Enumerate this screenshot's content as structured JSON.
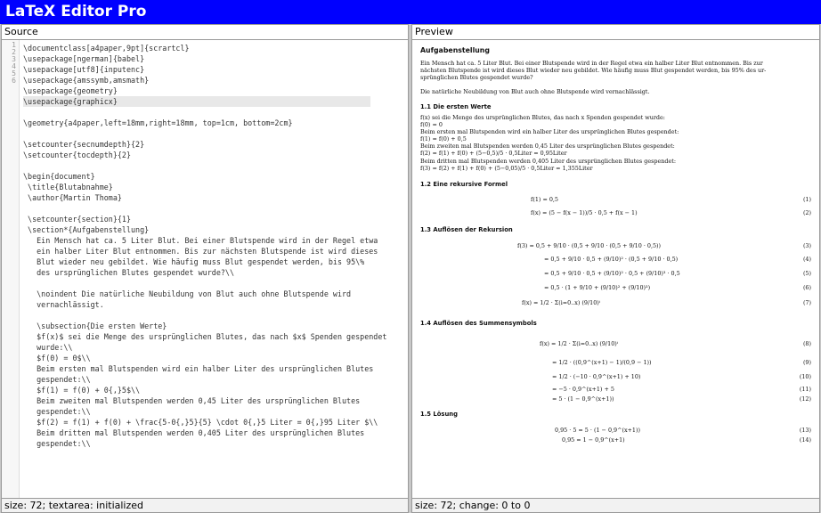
{
  "app": {
    "title": "LaTeX Editor Pro"
  },
  "source": {
    "header": "Source",
    "footer": "size: 72; textarea: initialized",
    "gutter": [
      "1",
      "2",
      "3",
      "4",
      "5",
      "6"
    ],
    "lines": [
      "\\documentclass[a4paper,9pt]{scrartcl}",
      "\\usepackage[ngerman]{babel}",
      "\\usepackage[utf8]{inputenc}",
      "\\usepackage{amssymb,amsmath}",
      "\\usepackage{geometry}",
      "\\usepackage{graphicx}",
      "",
      "\\geometry{a4paper,left=18mm,right=18mm, top=1cm, bottom=2cm}",
      "",
      "\\setcounter{secnumdepth}{2}",
      "\\setcounter{tocdepth}{2}",
      "",
      "\\begin{document}",
      " \\title{Blutabnahme}",
      " \\author{Martin Thoma}",
      "",
      " \\setcounter{section}{1}",
      " \\section*{Aufgabenstellung}",
      "   Ein Mensch hat ca. 5 Liter Blut. Bei einer Blutspende wird in der Regel etwa",
      "   ein halber Liter Blut entnommen. Bis zur nächsten Blutspende ist wird dieses",
      "   Blut wieder neu gebildet. Wie häufig muss Blut gespendet werden, bis 95\\%",
      "   des ursprünglichen Blutes gespendet wurde?\\\\",
      "",
      "   \\noindent Die natürliche Neubildung von Blut auch ohne Blutspende wird",
      "   vernachlässigt.",
      "",
      "   \\subsection{Die ersten Werte}",
      "   $f(x)$ sei die Menge des ursprünglichen Blutes, das nach $x$ Spenden gespendet",
      "   wurde:\\\\",
      "   $f(0) = 0$\\\\",
      "   Beim ersten mal Blutspenden wird ein halber Liter des ursprünglichen Blutes",
      "   gespendet:\\\\",
      "   $f(1) = f(0) + 0{,}5$\\\\",
      "   Beim zweiten mal Blutspenden werden 0,45 Liter des ursprünglichen Blutes",
      "   gespendet:\\\\",
      "   $f(2) = f(1) + f(0) + \\frac{5-0{,}5}{5} \\cdot 0{,}5 Liter = 0{,}95 Liter $\\\\",
      "   Beim dritten mal Blutspenden werden 0,405 Liter des ursprünglichen Blutes",
      "   gespendet:\\\\"
    ]
  },
  "preview": {
    "header": "Preview",
    "footer": "size: 72; change: 0 to 0",
    "title": "Aufgabenstellung",
    "intro": [
      "Ein Mensch hat ca. 5 Liter Blut. Bei einer Blutspende wird in der Regel etwa ein halber Liter Blut entnommen. Bis zur",
      "nächsten Blutspende ist wird dieses Blut wieder neu gebildet. Wie häufig muss Blut gespendet werden, bis 95% des ur-",
      "sprünglichen Blutes gespendet wurde?"
    ],
    "note": "Die natürliche Neubildung von Blut auch ohne Blutspende wird vernachlässigt.",
    "s1": {
      "title": "1.1  Die ersten Werte",
      "lines": [
        "f(x) sei die Menge des ursprünglichen Blutes, das nach x Spenden gespendet wurde:",
        "f(0) = 0",
        "Beim ersten mal Blutspenden wird ein halber Liter des ursprünglichen Blutes gespendet:",
        "f(1) = f(0) + 0,5",
        "Beim zweiten mal Blutspenden werden 0,45 Liter des ursprünglichen Blutes gespendet:",
        "f(2) = f(1) + f(0) + (5−0,5)/5 · 0,5Liter = 0,95Liter",
        "Beim dritten mal Blutspenden werden 0,405 Liter des ursprünglichen Blutes gespendet:",
        "f(3) = f(2) + f(1) + f(0) + (5−0,05)/5 · 0,5Liter = 1,355Liter"
      ]
    },
    "s2": {
      "title": "1.2  Eine rekursive Formel",
      "eqs": [
        {
          "t": "f(1) = 0,5",
          "n": "(1)"
        },
        {
          "t": "f(x) = (5 − f(x − 1))/5 · 0,5 + f(x − 1)",
          "n": "(2)"
        }
      ]
    },
    "s3": {
      "title": "1.3  Auflösen der Rekursion",
      "eqs": [
        {
          "t": "f(3) = 0,5 + 9/10 · (0,5 + 9/10 · (0,5 + 9/10 · 0,5))",
          "n": "(3)"
        },
        {
          "t": "= 0,5 + 9/10 · 0,5 + (9/10)² · (0,5 + 9/10 · 0,5)",
          "n": "(4)"
        },
        {
          "t": "= 0,5 + 9/10 · 0,5 + (9/10)² · 0,5 + (9/10)³ · 0,5",
          "n": "(5)"
        },
        {
          "t": "= 0,5 · (1 + 9/10 + (9/10)² + (9/10)³)",
          "n": "(6)"
        },
        {
          "t": "f(x) = 1/2 · Σ(i=0..x) (9/10)ⁱ",
          "n": "(7)"
        }
      ]
    },
    "s4": {
      "title": "1.4  Auflösen des Summensymbols",
      "eqs": [
        {
          "t": "f(x) = 1/2 · Σ(i=0..x) (9/10)ⁱ",
          "n": "(8)"
        },
        {
          "t": "= 1/2 · ((0,9^(x+1) − 1)/(0,9 − 1))",
          "n": "(9)"
        },
        {
          "t": "= 1/2 · (−10 · 0,9^(x+1) + 10)",
          "n": "(10)"
        },
        {
          "t": "= −5 · 0,9^(x+1) + 5",
          "n": "(11)"
        },
        {
          "t": "= 5 · (1 − 0,9^(x+1))",
          "n": "(12)"
        }
      ]
    },
    "s5": {
      "title": "1.5  Lösung",
      "eqs": [
        {
          "t": "0,95 · 5 = 5 · (1 − 0,9^(x+1))",
          "n": "(13)"
        },
        {
          "t": "0,95 = 1 − 0,9^(x+1)",
          "n": "(14)"
        }
      ]
    }
  }
}
